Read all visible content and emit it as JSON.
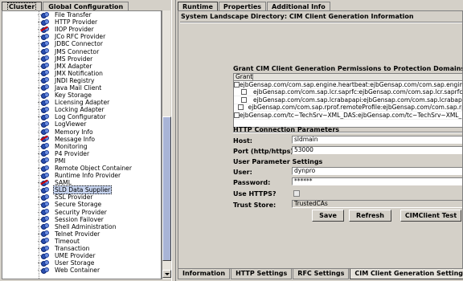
{
  "left_tabs": [
    "Cluster",
    "Global Configuration"
  ],
  "services": [
    {
      "label": "File Transfer",
      "stopped": false
    },
    {
      "label": "HTTP Provider",
      "stopped": false
    },
    {
      "label": "IIOP Provider",
      "stopped": true
    },
    {
      "label": "JCo RFC Provider",
      "stopped": false
    },
    {
      "label": "JDBC Connector",
      "stopped": false
    },
    {
      "label": "JMS Connector",
      "stopped": false
    },
    {
      "label": "JMS Provider",
      "stopped": false
    },
    {
      "label": "JMX Adapter",
      "stopped": false
    },
    {
      "label": "JMX Notification",
      "stopped": false
    },
    {
      "label": "JNDI Registry",
      "stopped": false
    },
    {
      "label": "Java Mail Client",
      "stopped": false
    },
    {
      "label": "Key Storage",
      "stopped": false
    },
    {
      "label": "Licensing Adapter",
      "stopped": false
    },
    {
      "label": "Locking Adapter",
      "stopped": false
    },
    {
      "label": "Log Configurator",
      "stopped": false
    },
    {
      "label": "LogViewer",
      "stopped": false
    },
    {
      "label": "Memory Info",
      "stopped": false
    },
    {
      "label": "Message Info",
      "stopped": true
    },
    {
      "label": "Monitoring",
      "stopped": false
    },
    {
      "label": "P4 Provider",
      "stopped": false
    },
    {
      "label": "PMI",
      "stopped": false
    },
    {
      "label": "Remote Object Container",
      "stopped": false
    },
    {
      "label": "Runtime Info Provider",
      "stopped": false
    },
    {
      "label": "SAML",
      "stopped": true
    },
    {
      "label": "SLD Data Supplier",
      "stopped": false,
      "selected": true
    },
    {
      "label": "SSL Provider",
      "stopped": false
    },
    {
      "label": "Secure Storage",
      "stopped": false
    },
    {
      "label": "Security Provider",
      "stopped": false
    },
    {
      "label": "Session Failover",
      "stopped": false
    },
    {
      "label": "Shell Administration",
      "stopped": false
    },
    {
      "label": "Telnet Provider",
      "stopped": false
    },
    {
      "label": "Timeout",
      "stopped": false
    },
    {
      "label": "Transaction",
      "stopped": false
    },
    {
      "label": "UME Provider",
      "stopped": false
    },
    {
      "label": "User Storage",
      "stopped": false
    },
    {
      "label": "Web Container",
      "stopped": false
    }
  ],
  "right_tabs": [
    "Runtime",
    "Properties",
    "Additional Info"
  ],
  "section_title": "System Landscape Directory: CIM Client Generation Information",
  "grant": {
    "title": "Grant CIM Client Generation Permissions to Protection Domains  [Do",
    "column_header": "Grant",
    "rows": [
      "ejbGensap.com/com.sap.engine.heartbeat:ejbGensap.com/com.sap.engine.heartbeat",
      "ejbGensap.com/com.sap.lcr.saprfc:ejbGensap.com/com.sap.lcr.saprfc",
      "ejbGensap.com/com.sap.lcrabapapi:ejbGensap.com/com.sap.lcrabapapi",
      "ejbGensap.com/com.sap.rprof.remoteProfile:ejbGensap.com/com.sap.rprof",
      "ejbGensap.com/tc~TechSrv~XML_DAS:ejbGensap.com/tc~TechSrv~XML_DAS"
    ]
  },
  "http": {
    "title": "HTTP Connection Parameters",
    "host_label": "Host:",
    "host_value": "sldmain",
    "port_label": "Port (http/https):",
    "port_value": "53000"
  },
  "user": {
    "title": "User Parameter Settings",
    "user_label": "User:",
    "user_value": "dynpro",
    "password_label": "Password:",
    "password_value": "******",
    "https_label": "Use HTTPS?",
    "truststore_label": "Trust Store:",
    "truststore_value": "TrustedCAs"
  },
  "buttons": {
    "save": "Save",
    "refresh": "Refresh",
    "test": "CIMClient Test"
  },
  "bottom_tabs": [
    "Information",
    "HTTP Settings",
    "RFC Settings",
    "CIM Client Generation Settings"
  ]
}
